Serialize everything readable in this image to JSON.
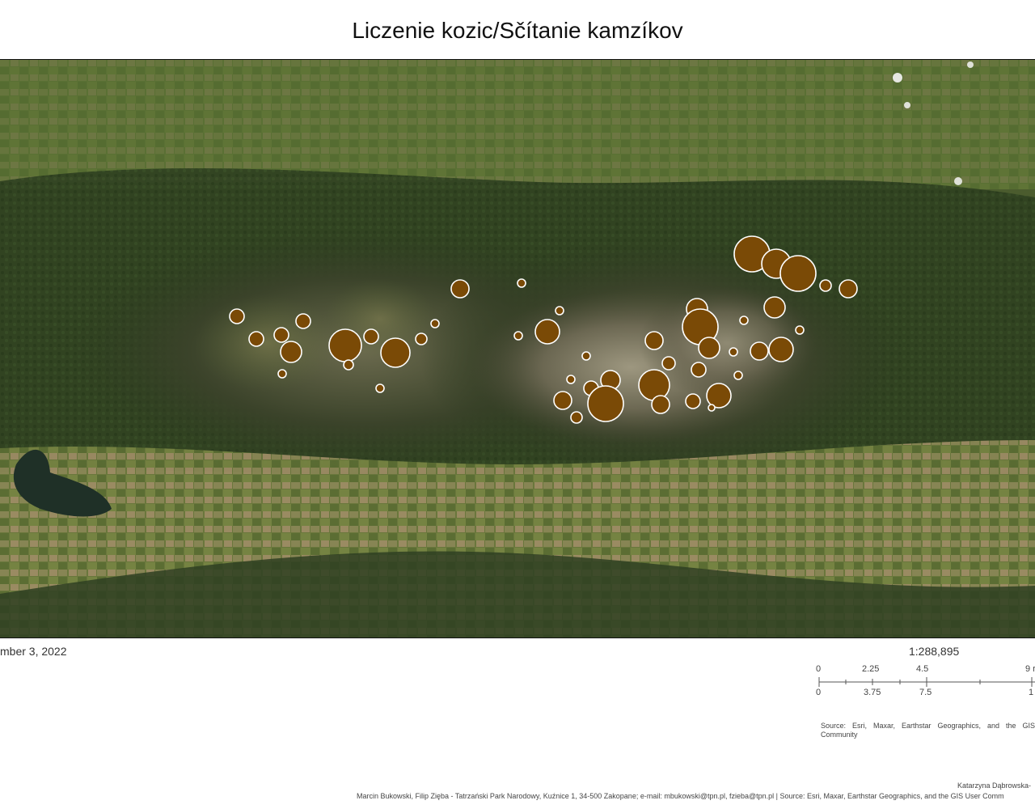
{
  "title": "Liczenie kozic/Sčítanie kamzíkov",
  "date": "mber 3, 2022",
  "scale": {
    "ratio": "1:288,895",
    "top_labels": [
      "0",
      "2.25",
      "4.5",
      "9 r"
    ],
    "bottom_labels": [
      "0",
      "3.75",
      "7.5",
      "1"
    ]
  },
  "source_text": "Source: Esri, Maxar, Earthstar Geographics, and the GIS Community",
  "author": "Katarzyna Dąbrowska-",
  "credits": "Marcin Bukowski, Filip Zięba - Tatrzański Park Narodowy, Kuźnice 1, 34-500 Zakopane; e-mail: mbukowski@tpn.pl, fzieba@tpn.pl | Source: Esri, Maxar, Earthstar Geographics, and the GIS User Comm",
  "colors": {
    "symbol_fill": "#7a4a06",
    "symbol_stroke": "#ffffff"
  },
  "map": {
    "basemap": "satellite imagery",
    "symbol_type": "proportional circles",
    "symbol_count": 48
  }
}
